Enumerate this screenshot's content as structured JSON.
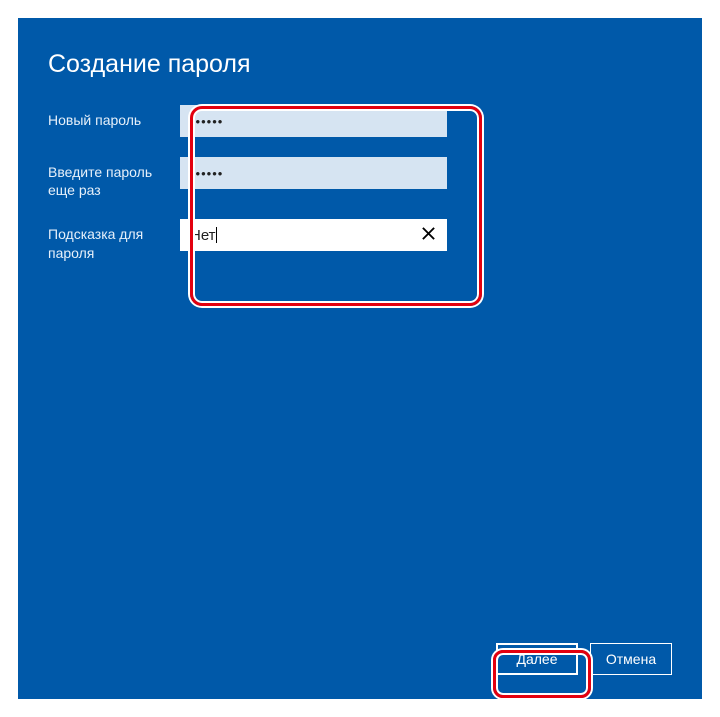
{
  "title": "Создание пароля",
  "fields": {
    "new_password": {
      "label": "Новый пароль",
      "value": "••••••"
    },
    "confirm_password": {
      "label": "Введите пароль еще раз",
      "value": "••••••"
    },
    "hint": {
      "label": "Подсказка для пароля",
      "value": "Нет"
    }
  },
  "buttons": {
    "next": "Далее",
    "cancel": "Отмена"
  }
}
